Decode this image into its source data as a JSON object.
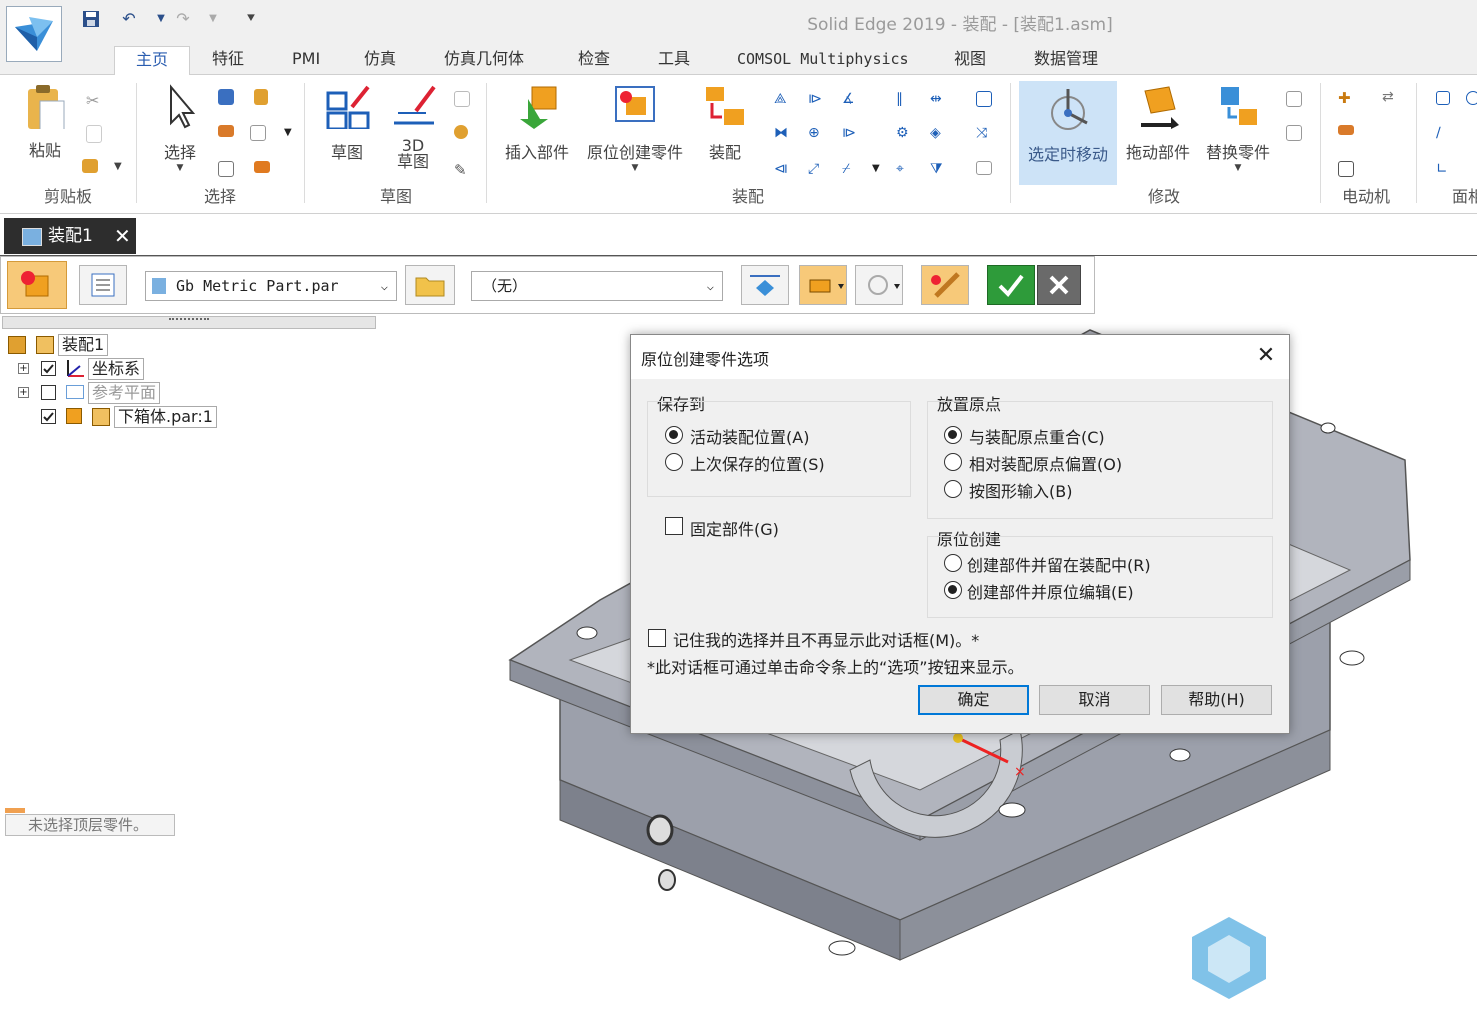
{
  "app": {
    "title": "Solid Edge 2019 - 装配 - [装配1.asm]"
  },
  "ribbon": {
    "tabs": [
      "主页",
      "特征",
      "PMI",
      "仿真",
      "仿真几何体",
      "检查",
      "工具",
      "COMSOL Multiphysics",
      "视图",
      "数据管理"
    ],
    "active_tab": "主页",
    "buttons": {
      "paste": "粘贴",
      "select": "选择",
      "sketch": "草图",
      "sketch3d_line1": "3D",
      "sketch3d_line2": "草图",
      "insert_part": "插入部件",
      "create_in_place": "原位创建零件",
      "assemble": "装配",
      "move_on_select": "选定时移动",
      "drag_component": "拖动部件",
      "replace_part": "替换零件"
    },
    "groups": {
      "clipboard": "剪贴板",
      "select": "选择",
      "sketch": "草图",
      "assembly": "装配",
      "modify": "修改",
      "motor": "电动机",
      "face": "面相"
    }
  },
  "document": {
    "tab_label": "装配1"
  },
  "command_bar": {
    "template_value": "Gb Metric Part.par",
    "location_value": "（无）"
  },
  "pathfinder": {
    "root": "装配1",
    "nodes": [
      {
        "label": "坐标系",
        "checked": true
      },
      {
        "label": "参考平面",
        "checked": false
      },
      {
        "label": "下箱体.par:1",
        "checked": true
      }
    ],
    "status": "未选择顶层零件。"
  },
  "dialog": {
    "title": "原位创建零件选项",
    "save_to": {
      "label": "保存到",
      "options": [
        "活动装配位置(A)",
        "上次保存的位置(S)"
      ],
      "selected": 0
    },
    "origin": {
      "label": "放置原点",
      "options": [
        "与装配原点重合(C)",
        "相对装配原点偏置(O)",
        "按图形输入(B)"
      ],
      "selected": 0
    },
    "fixed_part": {
      "label": "固定部件(G)",
      "checked": false
    },
    "in_place": {
      "label": "原位创建",
      "options": [
        "创建部件并留在装配中(R)",
        "创建部件并原位编辑(E)"
      ],
      "selected": 1
    },
    "remember": {
      "label": "记住我的选择并且不再显示此对话框(M)。*",
      "checked": false
    },
    "note": "*此对话框可通过单击命令条上的“选项”按钮来显示。",
    "buttons": {
      "ok": "确定",
      "cancel": "取消",
      "help": "帮助(H)"
    }
  },
  "colors": {
    "accent": "#0078d7",
    "model_gray": "#9ca0ab",
    "active_tab_text": "#2a5db0"
  }
}
